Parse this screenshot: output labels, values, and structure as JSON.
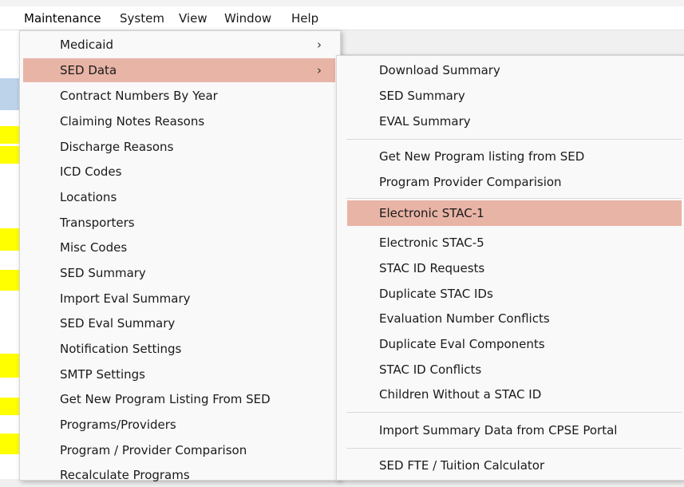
{
  "menubar": {
    "items": [
      "Maintenance",
      "System",
      "View",
      "Window",
      "Help"
    ]
  },
  "maintenance_menu": {
    "items": [
      {
        "label": "Medicaid",
        "submenu": true
      },
      {
        "label": "SED Data",
        "submenu": true,
        "highlighted": true
      },
      {
        "label": "Contract Numbers By Year"
      },
      {
        "label": "Claiming Notes Reasons"
      },
      {
        "label": "Discharge Reasons"
      },
      {
        "label": "ICD Codes"
      },
      {
        "label": "Locations"
      },
      {
        "label": "Transporters"
      },
      {
        "label": "Misc Codes"
      },
      {
        "label": "SED Summary"
      },
      {
        "label": "Import Eval Summary"
      },
      {
        "label": "SED Eval Summary"
      },
      {
        "label": "Notification Settings"
      },
      {
        "label": "SMTP Settings"
      },
      {
        "label": "Get New Program Listing From SED"
      },
      {
        "label": "Programs/Providers"
      },
      {
        "label": "Program / Provider Comparison"
      },
      {
        "label": "Recalculate Programs"
      }
    ]
  },
  "sed_data_submenu": {
    "groups": [
      [
        "Download Summary",
        "SED Summary",
        "EVAL Summary"
      ],
      [
        "Get New Program listing from SED",
        "Program Provider Comparision"
      ],
      [
        "Electronic STAC-1",
        "Electronic STAC-5",
        "STAC ID Requests",
        "Duplicate STAC IDs",
        "Evaluation Number Conflicts",
        "Duplicate Eval Components",
        "STAC ID Conflicts",
        "Children Without a STAC ID"
      ],
      [
        "Import Summary Data from CPSE Portal"
      ],
      [
        "SED FTE / Tuition Calculator"
      ]
    ],
    "highlighted": "Electronic STAC-1"
  },
  "colors": {
    "highlight": "#e8b4a6",
    "menu_bg": "#f9f9f9",
    "bg_yellow": "#ffff00"
  },
  "icons": {
    "submenu_arrow": "chevron-right-icon"
  }
}
